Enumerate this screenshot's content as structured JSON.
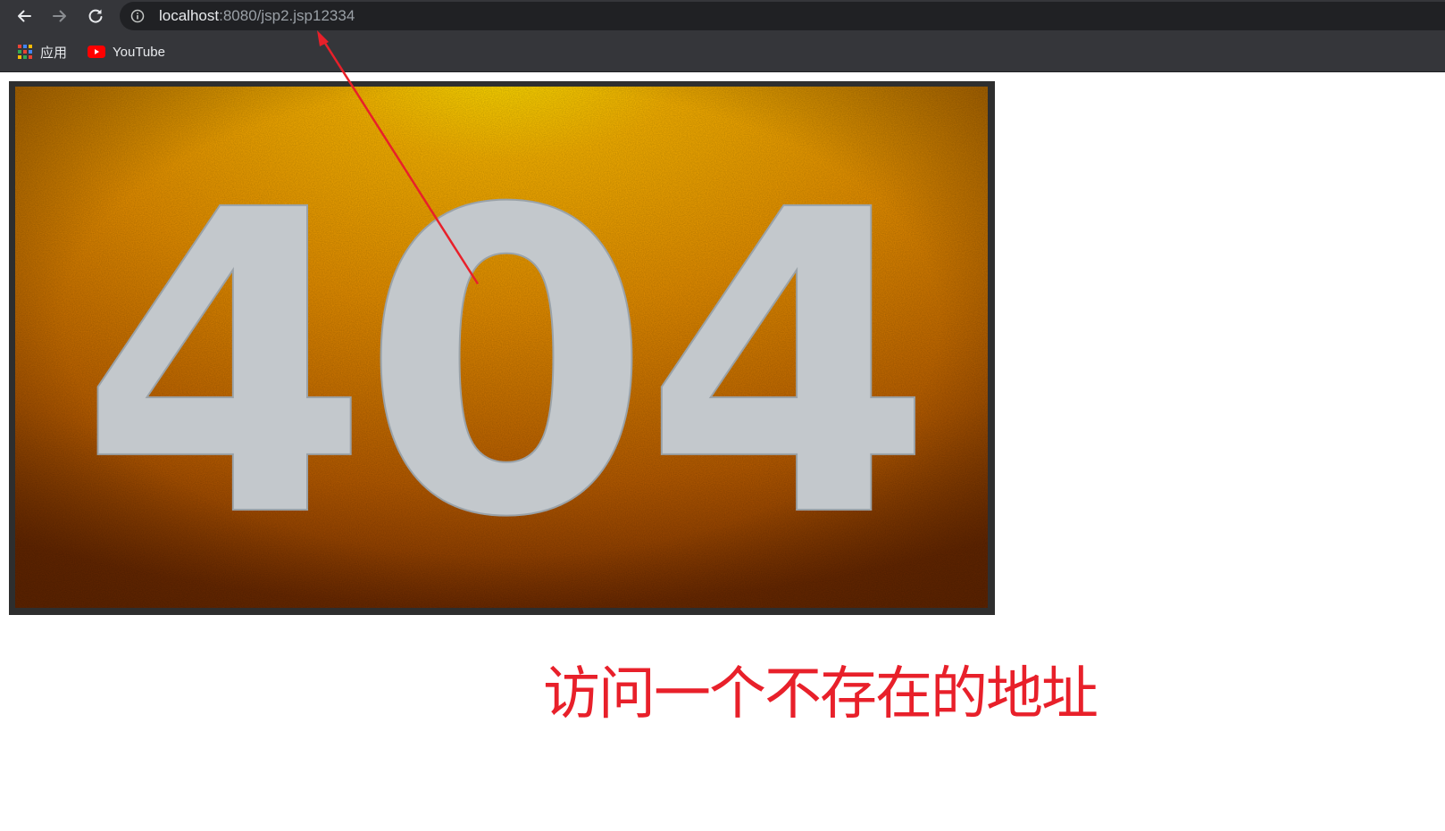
{
  "browser": {
    "url_host": "localhost",
    "url_rest": ":8080/jsp2.jsp12334",
    "back_icon": "arrow-left-icon",
    "forward_icon": "arrow-right-icon",
    "reload_icon": "reload-icon",
    "info_icon": "info-icon"
  },
  "bookmarks": {
    "items": [
      {
        "label": "应用",
        "icon": "apps-grid-icon"
      },
      {
        "label": "YouTube",
        "icon": "youtube-icon"
      }
    ]
  },
  "page": {
    "image_text": "404",
    "caption": "访问一个不存在的地址"
  },
  "colors": {
    "toolbar": "#35363a",
    "omnibox": "#202124",
    "caption": "#e8202a",
    "arrow": "#e8202a",
    "sign_background": "#e89000",
    "sign_digits": "#c3c8cc"
  }
}
